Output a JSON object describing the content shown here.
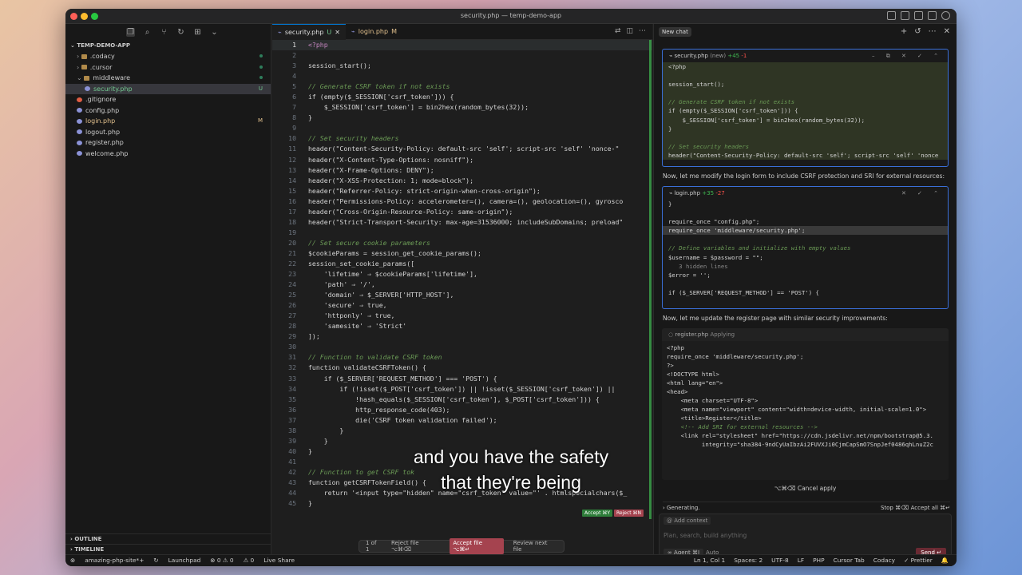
{
  "window": {
    "title": "security.php — temp-demo-app"
  },
  "sidebar": {
    "project": "TEMP-DEMO-APP",
    "files": [
      {
        "label": ".codacy",
        "type": "folder",
        "depth": 1,
        "status": "dot"
      },
      {
        "label": ".cursor",
        "type": "folder",
        "depth": 1,
        "status": "dot"
      },
      {
        "label": "middleware",
        "type": "folder-open",
        "depth": 1,
        "status": "dot"
      },
      {
        "label": "security.php",
        "type": "php",
        "depth": 2,
        "status": "U",
        "selected": true
      },
      {
        "label": ".gitignore",
        "type": "git",
        "depth": 1,
        "status": ""
      },
      {
        "label": "config.php",
        "type": "php",
        "depth": 1,
        "status": ""
      },
      {
        "label": "login.php",
        "type": "php",
        "depth": 1,
        "status": "M"
      },
      {
        "label": "logout.php",
        "type": "php",
        "depth": 1,
        "status": ""
      },
      {
        "label": "register.php",
        "type": "php",
        "depth": 1,
        "status": ""
      },
      {
        "label": "welcome.php",
        "type": "php",
        "depth": 1,
        "status": ""
      }
    ],
    "outline": "OUTLINE",
    "timeline": "TIMELINE"
  },
  "editor": {
    "tabs": [
      {
        "label": "security.php",
        "status": "U"
      },
      {
        "label": "login.php",
        "status": "M"
      }
    ],
    "lines": [
      {
        "n": "1",
        "t": "<?php",
        "cls": "kw"
      },
      {
        "n": "2",
        "t": ""
      },
      {
        "n": "3",
        "t": "session_start();"
      },
      {
        "n": "4",
        "t": ""
      },
      {
        "n": "5",
        "t": "// Generate CSRF token if not exists",
        "cls": "cm"
      },
      {
        "n": "6",
        "t": "if (empty($_SESSION['csrf_token'])) {"
      },
      {
        "n": "7",
        "t": "    $_SESSION['csrf_token'] = bin2hex(random_bytes(32));"
      },
      {
        "n": "8",
        "t": "}"
      },
      {
        "n": "9",
        "t": ""
      },
      {
        "n": "10",
        "t": "// Set security headers",
        "cls": "cm"
      },
      {
        "n": "11",
        "t": "header(\"Content-Security-Policy: default-src 'self'; script-src 'self' 'nonce-\""
      },
      {
        "n": "12",
        "t": "header(\"X-Content-Type-Options: nosniff\");"
      },
      {
        "n": "13",
        "t": "header(\"X-Frame-Options: DENY\");"
      },
      {
        "n": "14",
        "t": "header(\"X-XSS-Protection: 1; mode=block\");"
      },
      {
        "n": "15",
        "t": "header(\"Referrer-Policy: strict-origin-when-cross-origin\");"
      },
      {
        "n": "16",
        "t": "header(\"Permissions-Policy: accelerometer=(), camera=(), geolocation=(), gyrosco"
      },
      {
        "n": "17",
        "t": "header(\"Cross-Origin-Resource-Policy: same-origin\");"
      },
      {
        "n": "18",
        "t": "header(\"Strict-Transport-Security: max-age=31536000; includeSubDomains; preload\""
      },
      {
        "n": "19",
        "t": ""
      },
      {
        "n": "20",
        "t": "// Set secure cookie parameters",
        "cls": "cm"
      },
      {
        "n": "21",
        "t": "$cookieParams = session_get_cookie_params();"
      },
      {
        "n": "22",
        "t": "session_set_cookie_params(["
      },
      {
        "n": "23",
        "t": "    'lifetime' ⇒ $cookieParams['lifetime'],"
      },
      {
        "n": "24",
        "t": "    'path' ⇒ '/',"
      },
      {
        "n": "25",
        "t": "    'domain' ⇒ $_SERVER['HTTP_HOST'],"
      },
      {
        "n": "26",
        "t": "    'secure' ⇒ true,"
      },
      {
        "n": "27",
        "t": "    'httponly' ⇒ true,"
      },
      {
        "n": "28",
        "t": "    'samesite' ⇒ 'Strict'"
      },
      {
        "n": "29",
        "t": "]);"
      },
      {
        "n": "30",
        "t": ""
      },
      {
        "n": "31",
        "t": "// Function to validate CSRF token",
        "cls": "cm"
      },
      {
        "n": "32",
        "t": "function validateCSRFToken() {"
      },
      {
        "n": "33",
        "t": "    if ($_SERVER['REQUEST_METHOD'] === 'POST') {"
      },
      {
        "n": "34",
        "t": "        if (!isset($_POST['csrf_token']) || !isset($_SESSION['csrf_token']) ||"
      },
      {
        "n": "35",
        "t": "            !hash_equals($_SESSION['csrf_token'], $_POST['csrf_token'])) {"
      },
      {
        "n": "36",
        "t": "            http_response_code(403);"
      },
      {
        "n": "37",
        "t": "            die('CSRF token validation failed');"
      },
      {
        "n": "38",
        "t": "        }"
      },
      {
        "n": "39",
        "t": "    }"
      },
      {
        "n": "40",
        "t": "}"
      },
      {
        "n": "41",
        "t": ""
      },
      {
        "n": "42",
        "t": "// Function to get CSRF tok",
        "cls": "cm"
      },
      {
        "n": "43",
        "t": "function getCSRFTokenField() {"
      },
      {
        "n": "44",
        "t": "    return '<input type=\"hidden\" name=\"csrf_token\" value=\"' . htmlspecialchars($_"
      },
      {
        "n": "45",
        "t": "}"
      }
    ],
    "accept": "Accept ⌘Y",
    "reject": "Reject ⌘N",
    "filebar": {
      "nav": "1 of 1",
      "reject": "Reject file ⌥⌘⌫",
      "accept": "Accept file ⌥⌘↵",
      "review": "Review next file"
    }
  },
  "subtitle": {
    "line1": "and you have the safety",
    "line2": "that they're being"
  },
  "chat": {
    "new_chat": "New chat",
    "card1": {
      "file": "security.php",
      "tag": "(new)",
      "add": "+45",
      "del": "-1",
      "lines": [
        "<?php",
        "",
        "session_start();",
        "",
        "// Generate CSRF token if not exists",
        "if (empty($_SESSION['csrf_token'])) {",
        "    $_SESSION['csrf_token'] = bin2hex(random_bytes(32));",
        "}",
        "",
        "// Set security headers",
        "header(\"Content-Security-Policy: default-src 'self'; script-src 'self' 'nonce"
      ]
    },
    "msg1": "Now, let me modify the login form to include CSRF protection and SRI for external resources:",
    "card2": {
      "file": "login.php",
      "add": "+35",
      "del": "-27",
      "lines": [
        "}",
        "",
        "require_once \"config.php\";",
        "require_once 'middleware/security.php';",
        "",
        "// Define variables and initialize with empty values",
        "$username = $password = \"\";",
        "   3 hidden lines",
        "$error = '';",
        "",
        "if ($_SERVER['REQUEST_METHOD'] == 'POST') {"
      ]
    },
    "msg2": "Now, let me update the register page with similar security improvements:",
    "reg": {
      "file": "register.php",
      "status": "Applying",
      "lines": [
        "<?php",
        "require_once 'middleware/security.php';",
        "?>",
        "<!DOCTYPE html>",
        "<html lang=\"en\">",
        "<head>",
        "    <meta charset=\"UTF-8\">",
        "    <meta name=\"viewport\" content=\"width=device-width, initial-scale=1.0\">",
        "    <title>Register</title>",
        "    <!-- Add SRI for external resources -->",
        "    <link rel=\"stylesheet\" href=\"https://cdn.jsdelivr.net/npm/bootstrap@5.3.",
        "          integrity=\"sha384-9ndCyUaIbzAi2FUVXJi0CjmCapSmO7SnpJef0486qhLnuZ2c"
      ]
    },
    "cancel": "⌥⌘⌫ Cancel apply",
    "generating": "Generating.",
    "stop": "Stop ⌘⌫",
    "accept_all": "Accept all ⌘↵",
    "add_context": "@ Add context",
    "placeholder": "Plan, search, build anything",
    "agent": "∞ Agent ⌘I",
    "auto": "Auto",
    "send": "Send ↵"
  },
  "status": {
    "left": [
      "⊗",
      "amazing-php-site*+",
      "↻",
      "Launchpad",
      "⊗ 0 ⚠ 0",
      "⚠ 0",
      "Live Share"
    ],
    "right": [
      "Ln 1, Col 1",
      "Spaces: 2",
      "UTF-8",
      "LF",
      "PHP",
      "Cursor Tab",
      "Codacy",
      "✓ Prettier",
      "🔔"
    ]
  },
  "colors": {
    "accent": "#0078d4",
    "add": "#3fb950",
    "del": "#f85149",
    "modified": "#e2c08d",
    "untracked": "#73c991"
  }
}
